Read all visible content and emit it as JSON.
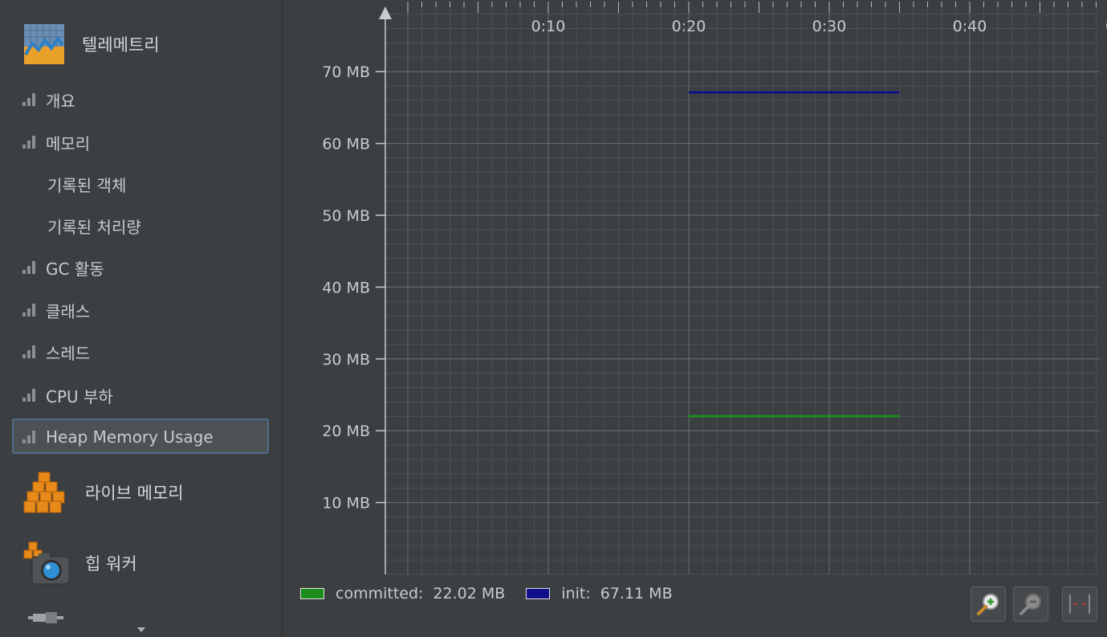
{
  "sidebar": {
    "telemetry": {
      "label": "텔레메트리",
      "icon": "telemetry-icon"
    },
    "items": [
      {
        "label": "개요",
        "icon": "bar-chart-icon"
      },
      {
        "label": "메모리",
        "icon": "bar-chart-icon"
      },
      {
        "label": "기록된 객체",
        "icon": ""
      },
      {
        "label": "기록된 처리량",
        "icon": ""
      },
      {
        "label": "GC 활동",
        "icon": "bar-chart-icon"
      },
      {
        "label": "클래스",
        "icon": "bar-chart-icon"
      },
      {
        "label": "스레드",
        "icon": "bar-chart-icon"
      },
      {
        "label": "CPU 부하",
        "icon": "bar-chart-icon"
      },
      {
        "label": "Heap Memory Usage",
        "icon": "bar-chart-icon",
        "selected": true
      }
    ],
    "live_memory": {
      "label": "라이브 메모리",
      "icon": "cubes-icon"
    },
    "heap_walker": {
      "label": "힙 워커",
      "icon": "camera-icon"
    }
  },
  "chart_data": {
    "type": "line",
    "x_ticks": [
      "0:10",
      "0:20",
      "0:30",
      "0:40",
      "0"
    ],
    "y_ticks": [
      "10 MB",
      "20 MB",
      "30 MB",
      "40 MB",
      "50 MB",
      "60 MB",
      "70 MB"
    ],
    "series": [
      {
        "name": "committed",
        "color": "#1c8c1c",
        "x_start": "0:20",
        "x_end": "0:35",
        "value_mb": 22.02
      },
      {
        "name": "init",
        "color": "#10108c",
        "x_start": "0:20",
        "x_end": "0:35",
        "value_mb": 67.11
      }
    ],
    "grid": true
  },
  "legend": {
    "committed": {
      "name": "committed:",
      "value": "22.02 MB",
      "color": "#1c8c1c"
    },
    "init": {
      "name": "init:",
      "value": "67.11 MB",
      "color": "#10108c"
    }
  },
  "toolbar": {
    "zoom_in": "zoom-in-icon",
    "zoom_out": "zoom-out-icon",
    "fit": "fit-width-icon"
  }
}
